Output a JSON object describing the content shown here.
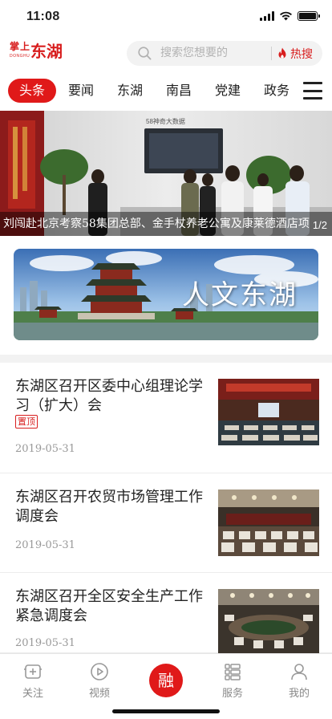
{
  "status_bar": {
    "time": "11:08"
  },
  "header": {
    "logo_top": "掌上",
    "logo_main": "东湖",
    "logo_sub": "DONGHU",
    "search_placeholder": "搜索您想要的",
    "hot_label": "热搜"
  },
  "tabs": [
    {
      "label": "头条",
      "active": true
    },
    {
      "label": "要闻",
      "active": false
    },
    {
      "label": "东湖",
      "active": false
    },
    {
      "label": "南昌",
      "active": false
    },
    {
      "label": "党建",
      "active": false
    },
    {
      "label": "政务",
      "active": false
    }
  ],
  "banner": {
    "sign_text": "58神奇大数据",
    "caption": "刘闯赴北京考察58集团总部、金手杖养老公寓及康莱德酒店项",
    "counter": "1/2"
  },
  "feature": {
    "title": "人文东湖"
  },
  "news": [
    {
      "title": "东湖区召开区委中心组理论学习（扩大）会",
      "tag": "置顶",
      "date": "2019-05-31"
    },
    {
      "title": "东湖区召开农贸市场管理工作调度会",
      "tag": "",
      "date": "2019-05-31"
    },
    {
      "title": "东湖区召开全区安全生产工作紧急调度会",
      "tag": "",
      "date": "2019-05-31"
    }
  ],
  "bottom_nav": {
    "items": [
      {
        "label": "关注",
        "icon": "plus-box-icon"
      },
      {
        "label": "视频",
        "icon": "play-circle-icon"
      },
      {
        "label": "融",
        "icon": "center-rong-button"
      },
      {
        "label": "服务",
        "icon": "service-list-icon"
      },
      {
        "label": "我的",
        "icon": "user-icon"
      }
    ]
  },
  "colors": {
    "accent": "#e01919",
    "text": "#222222",
    "muted": "#999999"
  }
}
